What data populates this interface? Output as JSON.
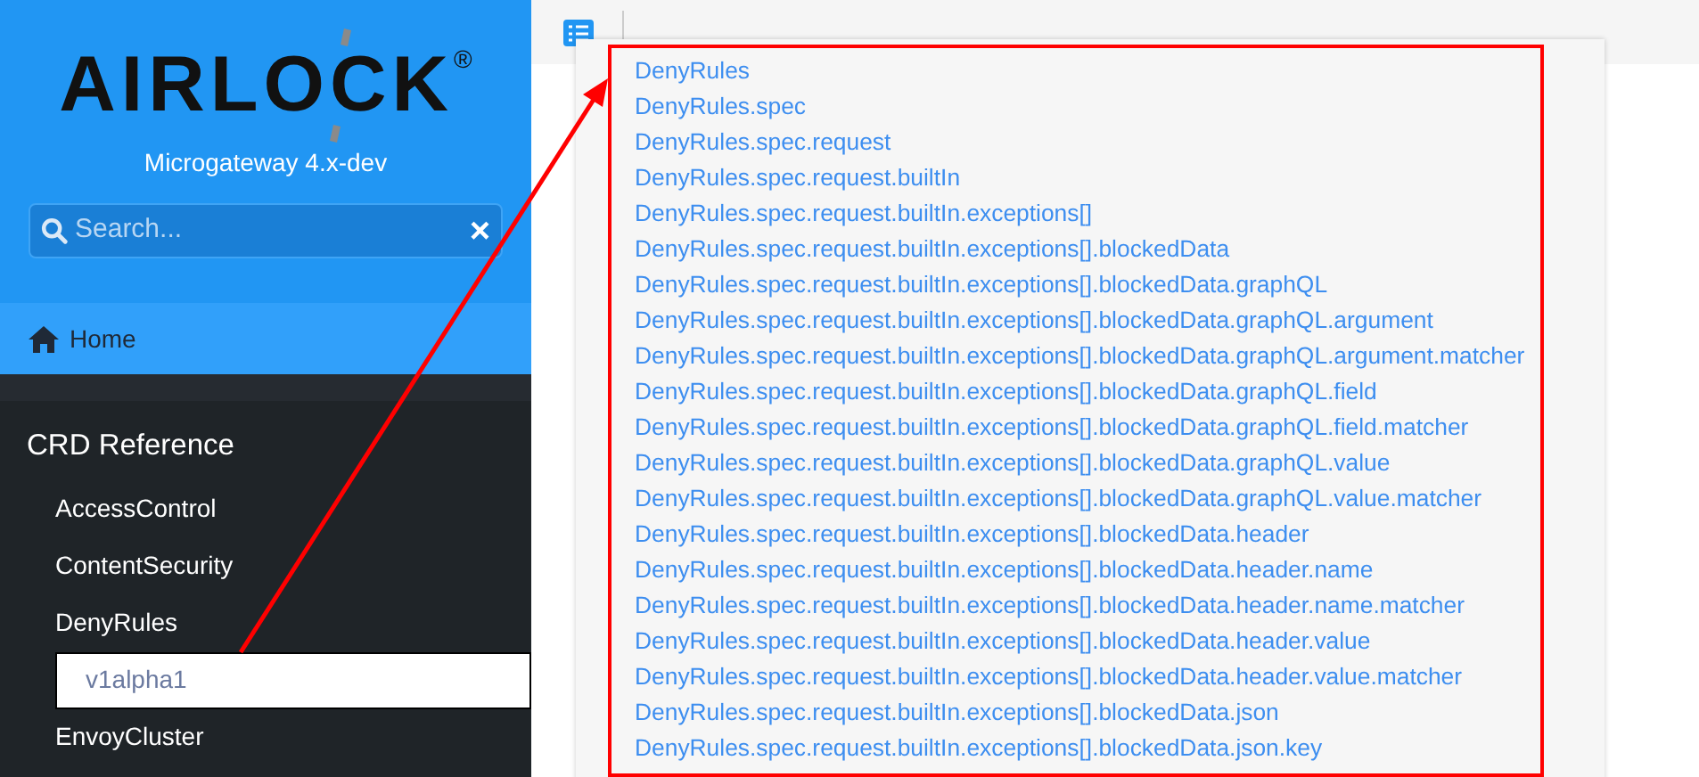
{
  "sidebar": {
    "logo": "AIRLOCK",
    "logo_mark": "®",
    "subtitle": "Microgateway 4.x-dev",
    "search": {
      "placeholder": "Search...",
      "clear": "×"
    },
    "home": "Home",
    "section": "CRD Reference",
    "items": [
      {
        "label": "AccessControl",
        "selected": false
      },
      {
        "label": "ContentSecurity",
        "selected": false
      },
      {
        "label": "DenyRules",
        "selected": false,
        "children": [
          {
            "label": "v1alpha1",
            "selected": true
          }
        ]
      },
      {
        "label": "EnvoyCluster",
        "selected": false
      }
    ]
  },
  "dropdown": {
    "items": [
      "DenyRules",
      "DenyRules.spec",
      "DenyRules.spec.request",
      "DenyRules.spec.request.builtIn",
      "DenyRules.spec.request.builtIn.exceptions[]",
      "DenyRules.spec.request.builtIn.exceptions[].blockedData",
      "DenyRules.spec.request.builtIn.exceptions[].blockedData.graphQL",
      "DenyRules.spec.request.builtIn.exceptions[].blockedData.graphQL.argument",
      "DenyRules.spec.request.builtIn.exceptions[].blockedData.graphQL.argument.matcher",
      "DenyRules.spec.request.builtIn.exceptions[].blockedData.graphQL.field",
      "DenyRules.spec.request.builtIn.exceptions[].blockedData.graphQL.field.matcher",
      "DenyRules.spec.request.builtIn.exceptions[].blockedData.graphQL.value",
      "DenyRules.spec.request.builtIn.exceptions[].blockedData.graphQL.value.matcher",
      "DenyRules.spec.request.builtIn.exceptions[].blockedData.header",
      "DenyRules.spec.request.builtIn.exceptions[].blockedData.header.name",
      "DenyRules.spec.request.builtIn.exceptions[].blockedData.header.name.matcher",
      "DenyRules.spec.request.builtIn.exceptions[].blockedData.header.value",
      "DenyRules.spec.request.builtIn.exceptions[].blockedData.header.value.matcher",
      "DenyRules.spec.request.builtIn.exceptions[].blockedData.json",
      "DenyRules.spec.request.builtIn.exceptions[].blockedData.json.key"
    ]
  }
}
